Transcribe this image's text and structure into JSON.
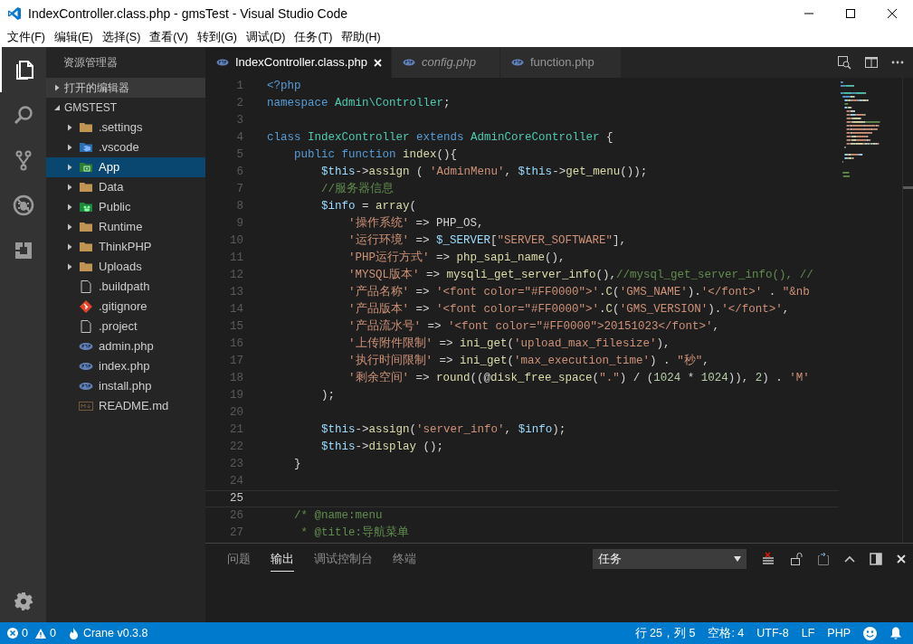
{
  "window": {
    "title": "IndexController.class.php - gmsTest - Visual Studio Code"
  },
  "menu": [
    "文件(F)",
    "编辑(E)",
    "选择(S)",
    "查看(V)",
    "转到(G)",
    "调试(D)",
    "任务(T)",
    "帮助(H)"
  ],
  "activity_bar": [
    {
      "kind": "files",
      "selected": true
    },
    {
      "kind": "search",
      "selected": false
    },
    {
      "kind": "git",
      "selected": false
    },
    {
      "kind": "debug",
      "selected": false
    },
    {
      "kind": "extensions",
      "selected": false
    }
  ],
  "sidebar": {
    "title": "资源管理器",
    "sections": [
      {
        "label": "打开的编辑器",
        "expanded": false
      },
      {
        "label": "GMSTEST",
        "expanded": true,
        "children": [
          {
            "label": ".settings",
            "kind": "folder",
            "expanded": false,
            "selected": false
          },
          {
            "label": ".vscode",
            "kind": "vscode-folder",
            "expanded": false,
            "selected": false
          },
          {
            "label": "App",
            "kind": "app-folder",
            "expanded": false,
            "selected": true
          },
          {
            "label": "Data",
            "kind": "folder",
            "expanded": false,
            "selected": false
          },
          {
            "label": "Public",
            "kind": "public-folder",
            "expanded": false,
            "selected": false
          },
          {
            "label": "Runtime",
            "kind": "folder",
            "expanded": false,
            "selected": false
          },
          {
            "label": "ThinkPHP",
            "kind": "folder",
            "expanded": false,
            "selected": false
          },
          {
            "label": "Uploads",
            "kind": "folder",
            "expanded": false,
            "selected": false
          },
          {
            "label": ".buildpath",
            "kind": "file",
            "selected": false
          },
          {
            "label": ".gitignore",
            "kind": "git",
            "selected": false
          },
          {
            "label": ".project",
            "kind": "file",
            "selected": false
          },
          {
            "label": "admin.php",
            "kind": "php",
            "selected": false
          },
          {
            "label": "index.php",
            "kind": "php",
            "selected": false
          },
          {
            "label": "install.php",
            "kind": "php",
            "selected": false
          },
          {
            "label": "README.md",
            "kind": "markdown",
            "selected": false
          }
        ]
      }
    ]
  },
  "tabs": [
    {
      "label": "IndexController.class.php",
      "selected": true,
      "preview": false
    },
    {
      "label": "config.php",
      "selected": false,
      "preview": true
    },
    {
      "label": "function.php",
      "selected": false,
      "preview": false
    }
  ],
  "editor": {
    "lines": [
      {
        "n": "1",
        "current": false,
        "tokens": [
          {
            "kind": "keyword",
            "text": "<?php"
          }
        ]
      },
      {
        "n": "2",
        "current": false,
        "tokens": [
          {
            "kind": "keyword",
            "text": "namespace "
          },
          {
            "kind": "type",
            "text": "Admin\\Controller"
          },
          {
            "kind": "plain",
            "text": ";"
          }
        ]
      },
      {
        "n": "3",
        "current": false
      },
      {
        "n": "4",
        "current": false,
        "tokens": [
          {
            "kind": "keyword",
            "text": "class "
          },
          {
            "kind": "type",
            "text": "IndexController "
          },
          {
            "kind": "keyword",
            "text": "extends "
          },
          {
            "kind": "type",
            "text": "AdminCoreController "
          },
          {
            "kind": "plain",
            "text": "{"
          }
        ]
      },
      {
        "n": "5",
        "current": false,
        "tokens": [
          {
            "kind": "keyword",
            "text": "    public function "
          },
          {
            "kind": "function",
            "text": "index"
          },
          {
            "kind": "plain",
            "text": "(){"
          }
        ]
      },
      {
        "n": "6",
        "current": false,
        "tokens": [
          {
            "kind": "variable",
            "text": "        $this"
          },
          {
            "kind": "plain",
            "text": "->"
          },
          {
            "kind": "function",
            "text": "assign"
          },
          {
            "kind": "plain",
            "text": " ( "
          },
          {
            "kind": "string",
            "text": "'AdminMenu'"
          },
          {
            "kind": "plain",
            "text": ", "
          },
          {
            "kind": "variable",
            "text": "$this"
          },
          {
            "kind": "plain",
            "text": "->"
          },
          {
            "kind": "function",
            "text": "get_menu"
          },
          {
            "kind": "plain",
            "text": "());"
          }
        ]
      },
      {
        "n": "7",
        "current": false,
        "tokens": [
          {
            "kind": "comment",
            "text": "        //服务器信息"
          }
        ]
      },
      {
        "n": "8",
        "current": false,
        "tokens": [
          {
            "kind": "variable",
            "text": "        $info"
          },
          {
            "kind": "plain",
            "text": " = "
          },
          {
            "kind": "function",
            "text": "array"
          },
          {
            "kind": "plain",
            "text": "("
          }
        ]
      },
      {
        "n": "9",
        "current": false,
        "tokens": [
          {
            "kind": "string",
            "text": "            '操作系统'"
          },
          {
            "kind": "plain",
            "text": " => PHP_OS,"
          }
        ]
      },
      {
        "n": "10",
        "current": false,
        "tokens": [
          {
            "kind": "string",
            "text": "            '运行环境'"
          },
          {
            "kind": "plain",
            "text": " => "
          },
          {
            "kind": "variable",
            "text": "$_SERVER"
          },
          {
            "kind": "plain",
            "text": "["
          },
          {
            "kind": "string",
            "text": "\"SERVER_SOFTWARE\""
          },
          {
            "kind": "plain",
            "text": "],"
          }
        ]
      },
      {
        "n": "11",
        "current": false,
        "tokens": [
          {
            "kind": "string",
            "text": "            'PHP运行方式'"
          },
          {
            "kind": "plain",
            "text": " => "
          },
          {
            "kind": "function",
            "text": "php_sapi_name"
          },
          {
            "kind": "plain",
            "text": "(),"
          }
        ]
      },
      {
        "n": "12",
        "current": false,
        "tokens": [
          {
            "kind": "string",
            "text": "            'MYSQL版本'"
          },
          {
            "kind": "plain",
            "text": " => "
          },
          {
            "kind": "function",
            "text": "mysqli_get_server_info"
          },
          {
            "kind": "plain",
            "text": "(),"
          },
          {
            "kind": "comment",
            "text": "//mysql_get_server_info(), //"
          }
        ]
      },
      {
        "n": "13",
        "current": false,
        "tokens": [
          {
            "kind": "string",
            "text": "            '产品名称'"
          },
          {
            "kind": "plain",
            "text": " => "
          },
          {
            "kind": "string",
            "text": "'<font color=\"#FF0000\">'"
          },
          {
            "kind": "plain",
            "text": "."
          },
          {
            "kind": "function",
            "text": "C"
          },
          {
            "kind": "plain",
            "text": "("
          },
          {
            "kind": "string",
            "text": "'GMS_NAME'"
          },
          {
            "kind": "plain",
            "text": ")."
          },
          {
            "kind": "string",
            "text": "'</font>'"
          },
          {
            "kind": "plain",
            "text": " . "
          },
          {
            "kind": "string",
            "text": "\"&nb"
          }
        ]
      },
      {
        "n": "14",
        "current": false,
        "tokens": [
          {
            "kind": "string",
            "text": "            '产品版本'"
          },
          {
            "kind": "plain",
            "text": " => "
          },
          {
            "kind": "string",
            "text": "'<font color=\"#FF0000\">'"
          },
          {
            "kind": "plain",
            "text": "."
          },
          {
            "kind": "function",
            "text": "C"
          },
          {
            "kind": "plain",
            "text": "("
          },
          {
            "kind": "string",
            "text": "'GMS_VERSION'"
          },
          {
            "kind": "plain",
            "text": ")."
          },
          {
            "kind": "string",
            "text": "'</font>'"
          },
          {
            "kind": "plain",
            "text": ","
          }
        ]
      },
      {
        "n": "15",
        "current": false,
        "tokens": [
          {
            "kind": "string",
            "text": "            '产品流水号'"
          },
          {
            "kind": "plain",
            "text": " => "
          },
          {
            "kind": "string",
            "text": "'<font color=\"#FF0000\">20151023</font>'"
          },
          {
            "kind": "plain",
            "text": ","
          }
        ]
      },
      {
        "n": "16",
        "current": false,
        "tokens": [
          {
            "kind": "string",
            "text": "            '上传附件限制'"
          },
          {
            "kind": "plain",
            "text": " => "
          },
          {
            "kind": "function",
            "text": "ini_get"
          },
          {
            "kind": "plain",
            "text": "("
          },
          {
            "kind": "string",
            "text": "'upload_max_filesize'"
          },
          {
            "kind": "plain",
            "text": "),"
          }
        ]
      },
      {
        "n": "17",
        "current": false,
        "tokens": [
          {
            "kind": "string",
            "text": "            '执行时间限制'"
          },
          {
            "kind": "plain",
            "text": " => "
          },
          {
            "kind": "function",
            "text": "ini_get"
          },
          {
            "kind": "plain",
            "text": "("
          },
          {
            "kind": "string",
            "text": "'max_execution_time'"
          },
          {
            "kind": "plain",
            "text": ") . "
          },
          {
            "kind": "string",
            "text": "\"秒\""
          },
          {
            "kind": "plain",
            "text": ","
          }
        ]
      },
      {
        "n": "18",
        "current": false,
        "tokens": [
          {
            "kind": "string",
            "text": "            '剩余空间'"
          },
          {
            "kind": "plain",
            "text": " => "
          },
          {
            "kind": "function",
            "text": "round"
          },
          {
            "kind": "plain",
            "text": "((@"
          },
          {
            "kind": "function",
            "text": "disk_free_space"
          },
          {
            "kind": "plain",
            "text": "("
          },
          {
            "kind": "string",
            "text": "\".\""
          },
          {
            "kind": "plain",
            "text": ") / ("
          },
          {
            "kind": "number",
            "text": "1024"
          },
          {
            "kind": "plain",
            "text": " * "
          },
          {
            "kind": "number",
            "text": "1024"
          },
          {
            "kind": "plain",
            "text": ")), "
          },
          {
            "kind": "number",
            "text": "2"
          },
          {
            "kind": "plain",
            "text": ") . "
          },
          {
            "kind": "string",
            "text": "'M'"
          }
        ]
      },
      {
        "n": "19",
        "current": false,
        "tokens": [
          {
            "kind": "plain",
            "text": "        );"
          }
        ]
      },
      {
        "n": "20",
        "current": false
      },
      {
        "n": "21",
        "current": false,
        "tokens": [
          {
            "kind": "variable",
            "text": "        $this"
          },
          {
            "kind": "plain",
            "text": "->"
          },
          {
            "kind": "function",
            "text": "assign"
          },
          {
            "kind": "plain",
            "text": "("
          },
          {
            "kind": "string",
            "text": "'server_info'"
          },
          {
            "kind": "plain",
            "text": ", "
          },
          {
            "kind": "variable",
            "text": "$info"
          },
          {
            "kind": "plain",
            "text": ");"
          }
        ]
      },
      {
        "n": "22",
        "current": false,
        "tokens": [
          {
            "kind": "variable",
            "text": "        $this"
          },
          {
            "kind": "plain",
            "text": "->"
          },
          {
            "kind": "function",
            "text": "display"
          },
          {
            "kind": "plain",
            "text": " ();"
          }
        ]
      },
      {
        "n": "23",
        "current": false,
        "tokens": [
          {
            "kind": "plain",
            "text": "    }"
          }
        ]
      },
      {
        "n": "24",
        "current": false
      },
      {
        "n": "25",
        "current": true
      },
      {
        "n": "26",
        "current": false,
        "tokens": [
          {
            "kind": "comment",
            "text": "    /* @name:menu"
          }
        ]
      },
      {
        "n": "27",
        "current": false,
        "tokens": [
          {
            "kind": "comment",
            "text": "     * @title:导航菜单"
          }
        ]
      }
    ]
  },
  "panel": {
    "tabs": [
      {
        "label": "问题",
        "selected": false
      },
      {
        "label": "输出",
        "selected": true
      },
      {
        "label": "调试控制台",
        "selected": false
      },
      {
        "label": "终端",
        "selected": false
      }
    ],
    "dropdown": "任务"
  },
  "status_bar": {
    "errors": "0",
    "warnings": "0",
    "extension": "Crane v0.3.8",
    "position": "行 25，列 5",
    "indent": "空格: 4",
    "encoding": "UTF-8",
    "eol": "LF",
    "language": "PHP"
  }
}
